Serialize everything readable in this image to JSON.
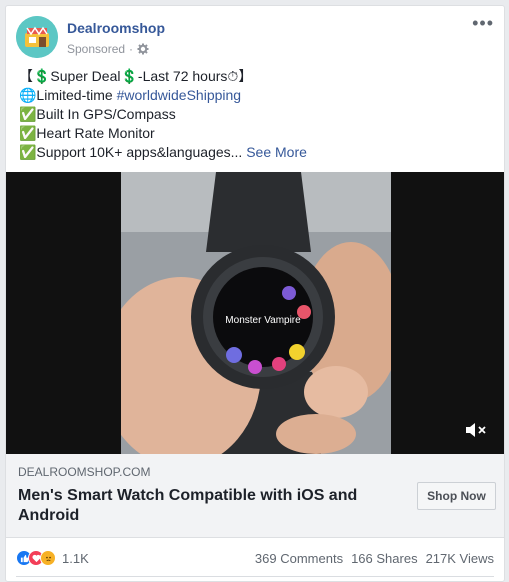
{
  "post": {
    "page_name": "Dealroomshop",
    "sponsored_label": "Sponsored",
    "lines": [
      "【💲Super Deal💲-Last 72 hours⏱】",
      "🌐Limited-time ",
      "✅Built In GPS/Compass",
      "✅Heart Rate Monitor",
      "✅Support 10K+ apps&languages..."
    ],
    "hashtag": "#worldwideShipping",
    "see_more": "See More"
  },
  "media": {
    "watch_screen_text": "Monster Vampire"
  },
  "link": {
    "domain": "DEALROOMSHOP.COM",
    "headline": "Men's Smart Watch Compatible with iOS and Android",
    "cta": "Shop Now"
  },
  "footer": {
    "reaction_count": "1.1K",
    "comments": "369 Comments",
    "shares": "166 Shares",
    "views": "217K Views"
  },
  "colors": {
    "link_blue": "#365899",
    "like_blue": "#1877f2",
    "love_red": "#f33e58",
    "wow_yellow": "#f7b125"
  }
}
